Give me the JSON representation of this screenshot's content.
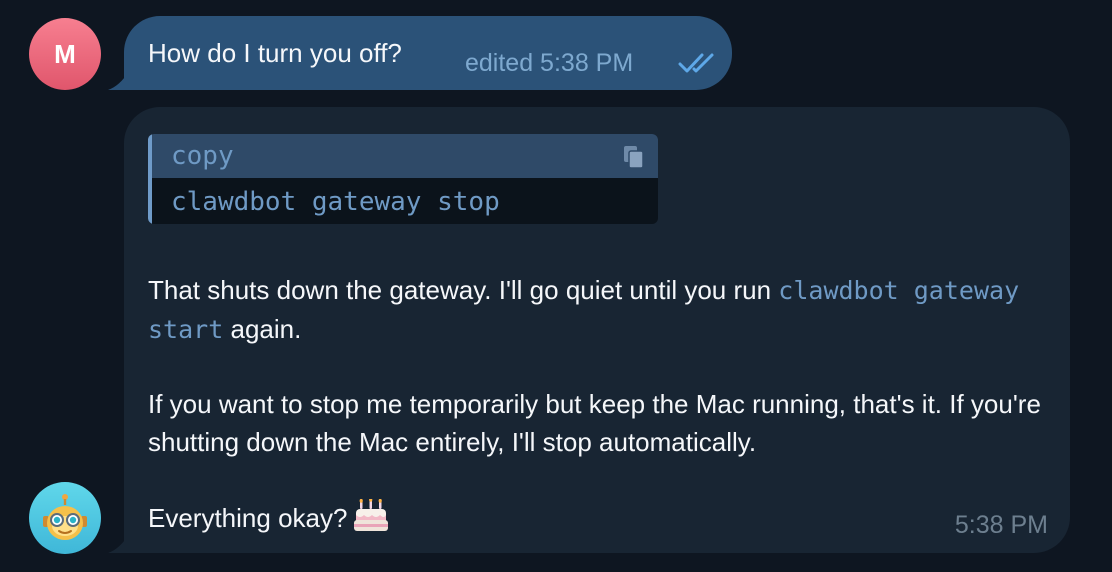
{
  "user": {
    "avatar_initial": "M",
    "avatar_color": "#e8647a"
  },
  "bot": {
    "avatar_icon": "robot-face-icon",
    "avatar_color": "#4cc6e0"
  },
  "outgoing": {
    "text": "How do I turn you off?",
    "meta": "edited 5:38 PM",
    "status_icon": "double-check-icon",
    "bubble_color": "#2b5278"
  },
  "incoming": {
    "code_block": {
      "language": "copy",
      "code": "clawdbot gateway stop",
      "copy_icon": "copy-icon"
    },
    "paragraph1": {
      "before": "That shuts down the gateway. I'll go quiet until you run ",
      "code": "clawdbot gateway start",
      "after": " again."
    },
    "paragraph2": "If you want to stop me temporarily but keep the Mac running, that's it. If you're shutting down the Mac entirely, I'll stop automatically.",
    "paragraph3": {
      "text": "Everything okay?",
      "emoji_icon": "birthday-cake-icon"
    },
    "time": "5:38 PM",
    "bubble_color": "#182533"
  },
  "colors": {
    "background": "#0e1621",
    "code_accent": "#6f9ac5",
    "text": "#f5f7fa"
  }
}
